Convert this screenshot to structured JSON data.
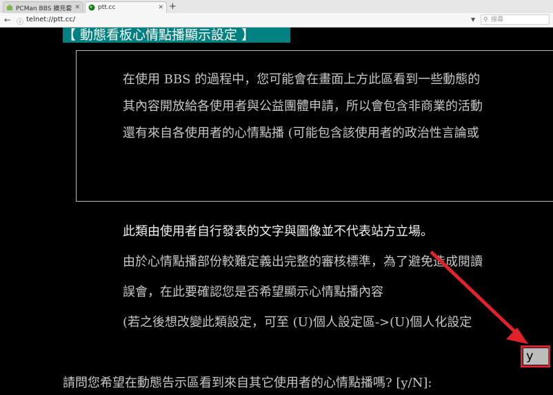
{
  "browser": {
    "tabs": [
      {
        "title": "PCMan BBS 擴充套件 :: Fi...",
        "active": false
      },
      {
        "title": "ptt.cc",
        "active": true
      }
    ],
    "address": "telnet://ptt.cc/",
    "search_placeholder": "搜尋"
  },
  "terminal": {
    "heading": "【 動態看板心情點播顯示設定 】",
    "box_lines": [
      "在使用 BBS 的過程中，您可能會在畫面上方此區看到一些動態的",
      "其內容開放給各使用者與公益團體申請，所以會包含非商業的活動",
      "還有來自各使用者的心情點播 (可能包含該使用者的政治性言論或"
    ],
    "notice_lines": [
      "此類由使用者自行發表的文字與圖像並不代表站方立場。",
      "由於心情點播部份較難定義出完整的審核標準，為了避免造成閱讀",
      "誤會，在此要確認您是否希望顯示心情點播內容",
      "(若之後想改變此類設定，可至 (U)個人設定區->(U)個人化設定"
    ],
    "prompt": "請問您希望在動態告示區看到來自其它使用者的心情點播嗎? [y/N]:",
    "answer": "y"
  },
  "colors": {
    "heading_bg": "#008080",
    "annotation": "#e2222a",
    "answer_bg": "#bdbdbd"
  }
}
